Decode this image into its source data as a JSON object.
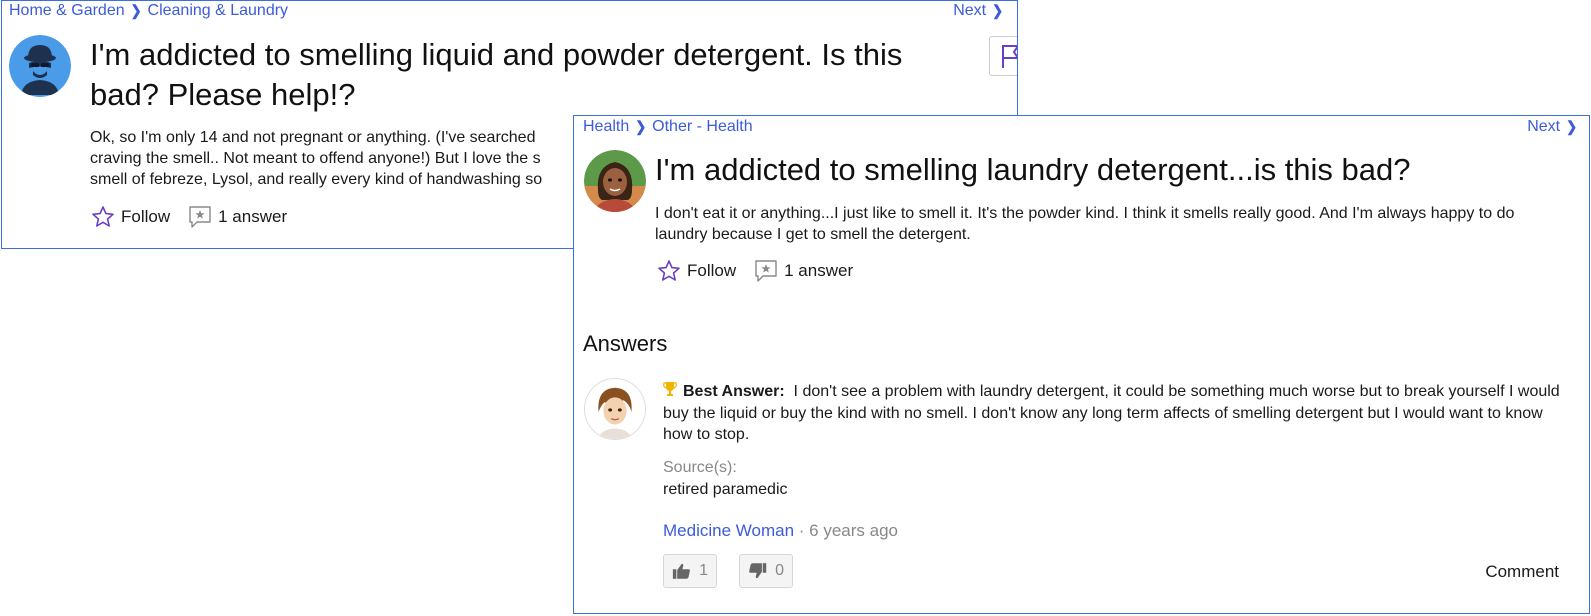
{
  "card1": {
    "breadcrumb": [
      "Home & Garden",
      "Cleaning & Laundry"
    ],
    "next_label": "Next",
    "title": "I'm addicted to smelling liquid and powder detergent. Is this bad? Please help!?",
    "body_lines": [
      "Ok, so I'm only 14 and not pregnant or anything. (I've searched",
      "craving the smell.. Not meant to offend anyone!) But I love the s",
      "smell of febreze, Lysol, and really every kind of handwashing so"
    ],
    "follow_label": "Follow",
    "answers_label": "1 answer"
  },
  "card2": {
    "breadcrumb": [
      "Health",
      "Other - Health"
    ],
    "next_label": "Next",
    "title": "I'm addicted to smelling laundry detergent...is this bad?",
    "body": "I don't eat it or anything...I just like to smell it. It's the powder kind. I think it smells really good. And I'm always happy to do laundry because I get to smell the detergent.",
    "follow_label": "Follow",
    "answers_label": "1 answer",
    "answers_heading": "Answers",
    "best_answer_label": "Best Answer:",
    "best_answer_text": "I don't see a problem with laundry detergent, it could be something much worse but to break yourself I would buy the liquid or buy the kind with no smell. I don't know any long term affects of smelling detergent but I would want to know how to stop.",
    "sources_label": "Source(s):",
    "sources_value": "retired paramedic",
    "author_name": "Medicine Woman",
    "separator": " · ",
    "author_time": "6 years ago",
    "upvotes": "1",
    "downvotes": "0",
    "comment_label": "Comment"
  },
  "colors": {
    "accent": "#3b5bdb",
    "card_border": "#3b6fe0",
    "star": "#6a3fc8",
    "muted": "#888888"
  },
  "icons": [
    "chevron-right-icon",
    "star-icon",
    "answer-bubble-icon",
    "flag-icon",
    "trophy-icon",
    "thumbs-up-icon",
    "thumbs-down-icon"
  ]
}
